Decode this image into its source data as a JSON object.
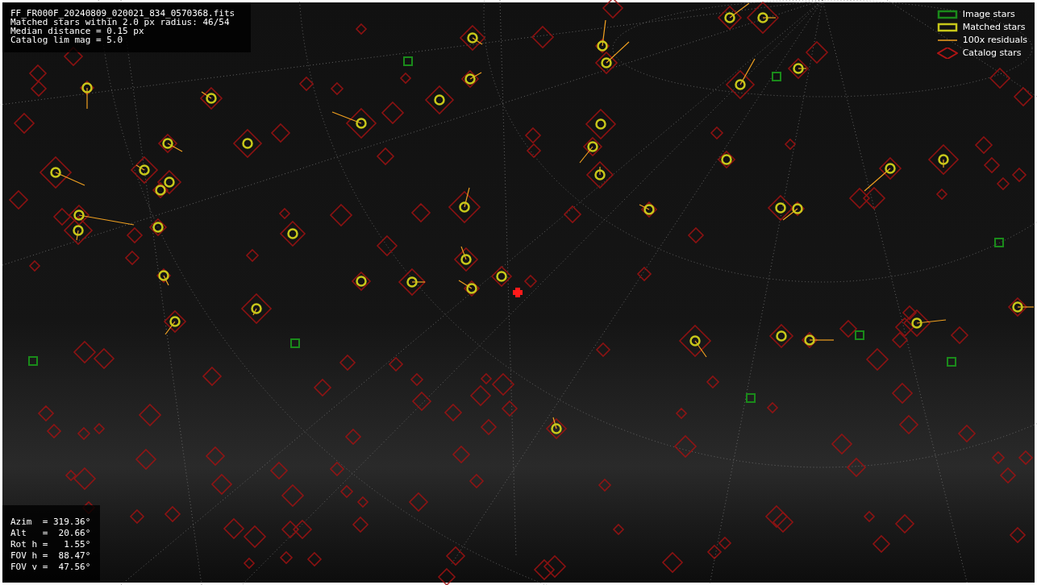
{
  "info_box": {
    "lines": [
      "FF_FR000F_20240809_020021_834_0570368.fits",
      "Matched stars within 2.0 px radius: 46/54",
      "Median distance = 0.15 px",
      "Catalog lim mag = 5.0"
    ]
  },
  "legend": {
    "items": [
      {
        "kind": "image",
        "label": "Image stars"
      },
      {
        "kind": "matched",
        "label": "Matched stars"
      },
      {
        "kind": "residual",
        "label": "100x residuals"
      },
      {
        "kind": "catalog",
        "label": "Catalog stars"
      }
    ]
  },
  "pointing_box": {
    "lines": [
      "Azim  = 319.36°",
      "Alt   =  20.66°",
      "Rot h =   1.55°",
      "FOV h =  88.47°",
      "FOV v =  47.56°"
    ]
  }
}
